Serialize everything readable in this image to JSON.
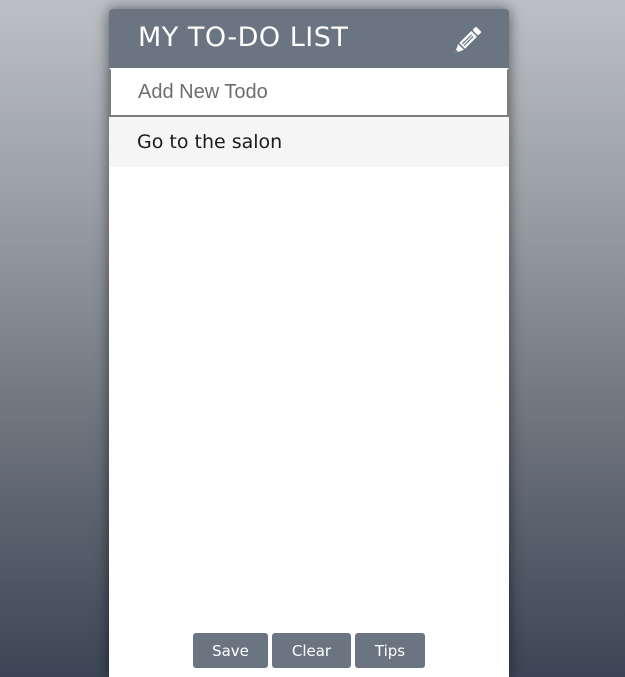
{
  "header": {
    "title": "MY TO-DO LIST",
    "edit_icon": "pencil-icon"
  },
  "input": {
    "placeholder": "Add New Todo",
    "value": ""
  },
  "todos": [
    {
      "text": "Go to the salon"
    }
  ],
  "footer": {
    "save_label": "Save",
    "clear_label": "Clear",
    "tips_label": "Tips"
  },
  "colors": {
    "accent": "#6b7582",
    "item_background": "#f5f5f5"
  }
}
